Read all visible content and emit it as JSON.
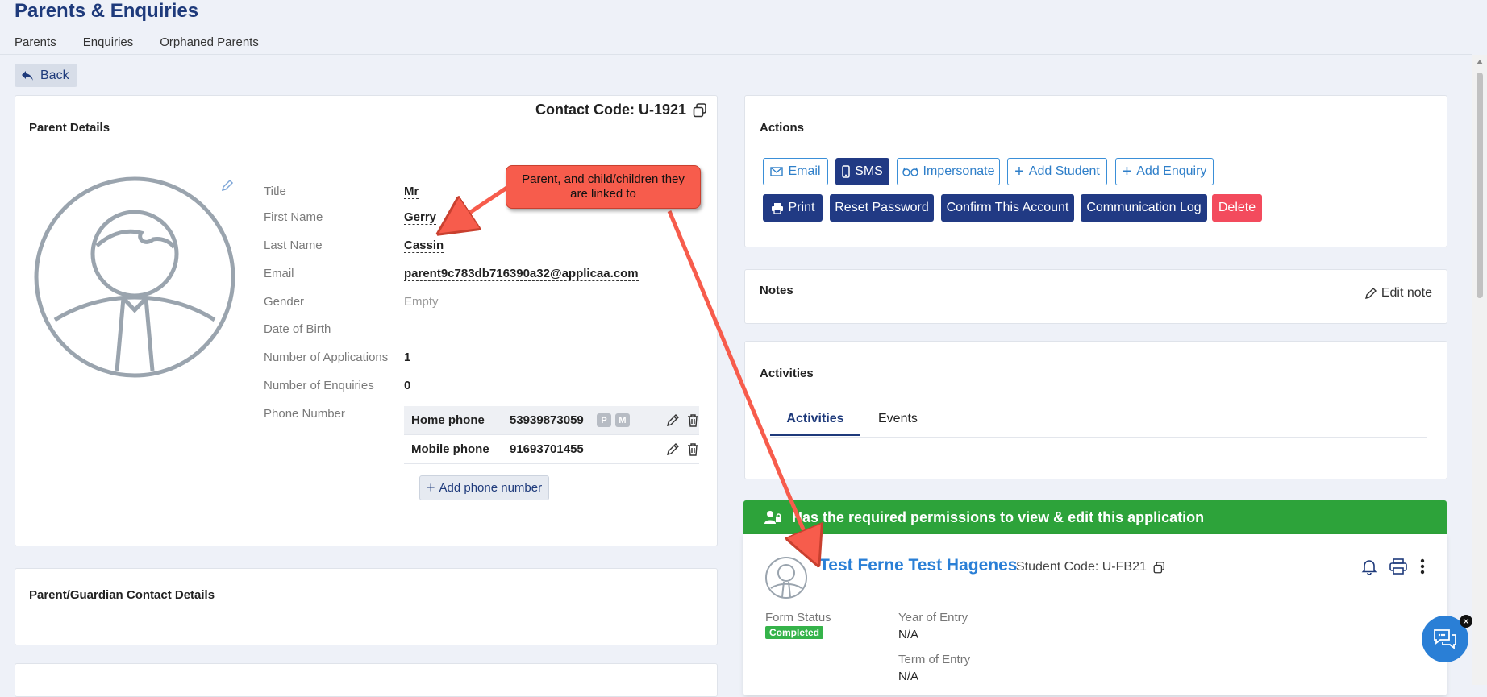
{
  "page": {
    "title": "Parents & Enquiries",
    "tabs": [
      "Parents",
      "Enquiries",
      "Orphaned Parents"
    ],
    "back_label": "Back"
  },
  "parent_details": {
    "title": "Parent Details",
    "contact_code": "Contact Code: U-1921",
    "fields": [
      {
        "label": "Title",
        "value": "Mr"
      },
      {
        "label": "First Name",
        "value": "Gerry"
      },
      {
        "label": "Last Name",
        "value": "Cassin"
      },
      {
        "label": "Email",
        "value": "parent9c783db716390a32@applicaa.com"
      },
      {
        "label": "Gender",
        "value": "Empty"
      },
      {
        "label": "Date of Birth",
        "value": ""
      },
      {
        "label": "Number of Applications",
        "value": "1"
      },
      {
        "label": "Number of Enquiries",
        "value": "0"
      },
      {
        "label": "Phone Number",
        "value": ""
      }
    ],
    "phones": [
      {
        "type": "Home phone",
        "number": "53939873059",
        "badges": [
          "P",
          "M"
        ]
      },
      {
        "type": "Mobile phone",
        "number": "91693701455",
        "badges": []
      }
    ],
    "add_phone_label": "Add phone number"
  },
  "contact_details": {
    "title": "Parent/Guardian Contact Details"
  },
  "actions": {
    "title": "Actions",
    "row1": [
      "Email",
      "SMS",
      "Impersonate",
      "Add Student",
      "Add Enquiry"
    ],
    "row2": [
      "Print",
      "Reset Password",
      "Confirm This Account",
      "Communication Log",
      "Delete"
    ]
  },
  "notes": {
    "title": "Notes",
    "edit_label": "Edit note"
  },
  "activities": {
    "title": "Activities",
    "tabs": [
      "Activities",
      "Events"
    ]
  },
  "permission_banner": "Has the required permissions to view & edit this application",
  "student": {
    "name": "Test Ferne Test Hagenes",
    "code": "Student Code: U-FB21",
    "form_status_label": "Form Status",
    "form_status": "Completed",
    "year_label": "Year of Entry",
    "year_value": "N/A",
    "term_label": "Term of Entry",
    "term_value": "N/A"
  },
  "annotation": {
    "text": "Parent, and child/children they are linked to"
  },
  "colors": {
    "navy": "#213a84",
    "accent_blue": "#2a7fd6",
    "danger": "#f34b5d",
    "success": "#2da33a",
    "callout": "#f75c4c"
  }
}
